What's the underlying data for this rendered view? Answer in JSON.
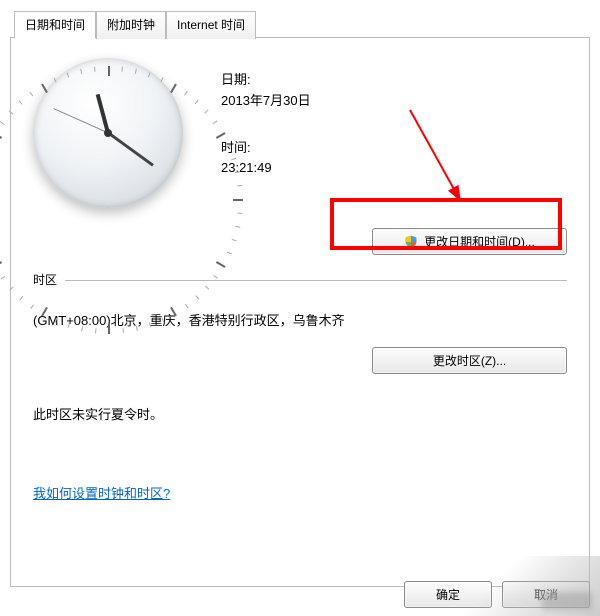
{
  "tabs": {
    "datetime": "日期和时间",
    "additional_clocks": "附加时钟",
    "internet_time": "Internet 时间"
  },
  "datetime_panel": {
    "date_label": "日期:",
    "date_value": "2013年7月30日",
    "time_label": "时间:",
    "time_value": "23:21:49",
    "change_datetime_button": "更改日期和时间(D)..."
  },
  "timezone_panel": {
    "header": "时区",
    "value": "(GMT+08:00)北京，重庆，香港特别行政区，乌鲁木齐",
    "change_timezone_button": "更改时区(Z)...",
    "dst_notice": "此时区未实行夏令时。"
  },
  "help_link": "我如何设置时钟和时区?",
  "dialog_buttons": {
    "ok": "确定",
    "cancel": "取消"
  },
  "clock": {
    "hour": 23,
    "minute": 21,
    "second": 49
  },
  "annotation": {
    "arrow_color": "#ff0000",
    "box_color": "#ff0000"
  }
}
